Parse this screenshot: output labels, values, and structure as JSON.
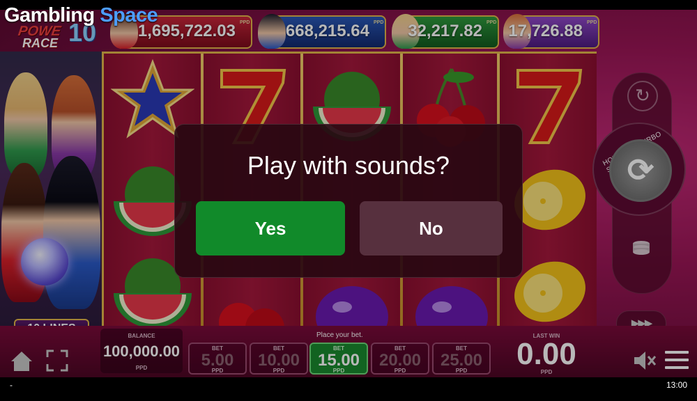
{
  "brand": {
    "part1": "Gambling",
    "part2": "Space"
  },
  "game_logo": {
    "line1": "POWE",
    "line2": "RACE",
    "number": "10"
  },
  "jackpots": [
    {
      "value": "1,695,722.03",
      "currency": "PPD"
    },
    {
      "value": "668,215.64",
      "currency": "PPD"
    },
    {
      "value": "32,217.82",
      "currency": "PPD"
    },
    {
      "value": "17,726.88",
      "currency": "PPD"
    }
  ],
  "lines_badge": "10 LINES",
  "reels": [
    [
      "blue-star",
      "watermelon",
      "watermelon"
    ],
    [
      "seven",
      "",
      "cherry"
    ],
    [
      "watermelon",
      "",
      "plum"
    ],
    [
      "cherry",
      "",
      "plum"
    ],
    [
      "seven",
      "lemon",
      "lemon"
    ]
  ],
  "controls": {
    "turbo_hint": "HOLD FOR TURBO SPIN",
    "autoplay_icon": "autoplay-icon",
    "spin_icon": "spin-icon",
    "coins_icon": "coins-icon",
    "speed_icon": "fast-forward-icon"
  },
  "bottom": {
    "balance_label": "BALANCE",
    "balance_value": "100,000.00",
    "currency": "PPD",
    "place_bet": "Place your bet.",
    "bet_label": "BET",
    "bets": [
      "5.00",
      "10.00",
      "15.00",
      "20.00",
      "25.00"
    ],
    "active_bet_index": 2,
    "last_win_label": "LAST WIN",
    "last_win_value": "0.00"
  },
  "dialog": {
    "question": "Play with sounds?",
    "yes": "Yes",
    "no": "No"
  },
  "status_bar": {
    "left": "-",
    "time": "13:00"
  },
  "colors": {
    "frame_gold": "#e2b64a",
    "active_bet": "#1a8a2e",
    "yes_button": "#118a2a",
    "no_button": "#57303e"
  }
}
